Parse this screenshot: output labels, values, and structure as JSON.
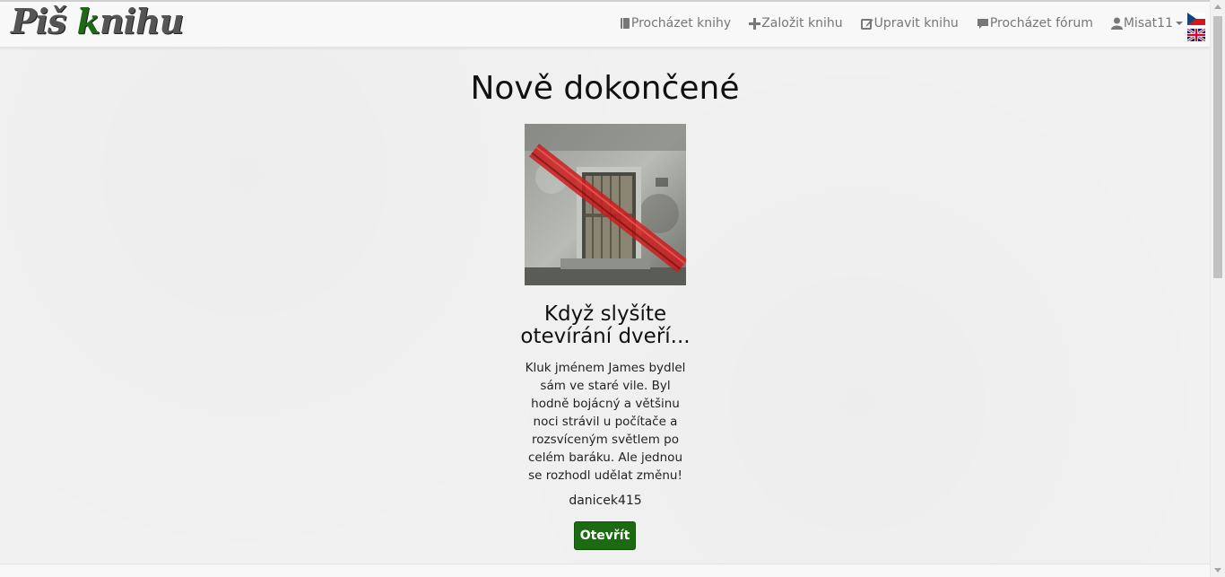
{
  "navbar": {
    "logo": {
      "part1": "Piš ",
      "part2_green": "k",
      "part3": "nihu"
    },
    "items": [
      {
        "label": "Procházet knihy",
        "icon": "book-icon"
      },
      {
        "label": "Založit knihu",
        "icon": "plus-icon"
      },
      {
        "label": "Upravit knihu",
        "icon": "edit-icon"
      },
      {
        "label": "Procházet fórum",
        "icon": "comment-icon"
      },
      {
        "label": "Misat11",
        "icon": "user-icon"
      }
    ],
    "languages": [
      "czech-flag-icon",
      "uk-flag-icon"
    ]
  },
  "main": {
    "heading": "Nově dokončené",
    "book": {
      "title": "Když slyšíte otevírání dveří...",
      "description": "Kluk jménem James bydlel sám ve staré vile. Byl hodně bojácný a většinu noci strávil u počítače a rozsvíceným světlem po celém baráku. Ale jednou se rozhodl udělat změnu!",
      "author": "danicek415",
      "open_label": "Otevřít"
    }
  },
  "colors": {
    "accent_green": "#1c6b12",
    "nav_text": "#777777",
    "background": "#f1f1f1"
  }
}
